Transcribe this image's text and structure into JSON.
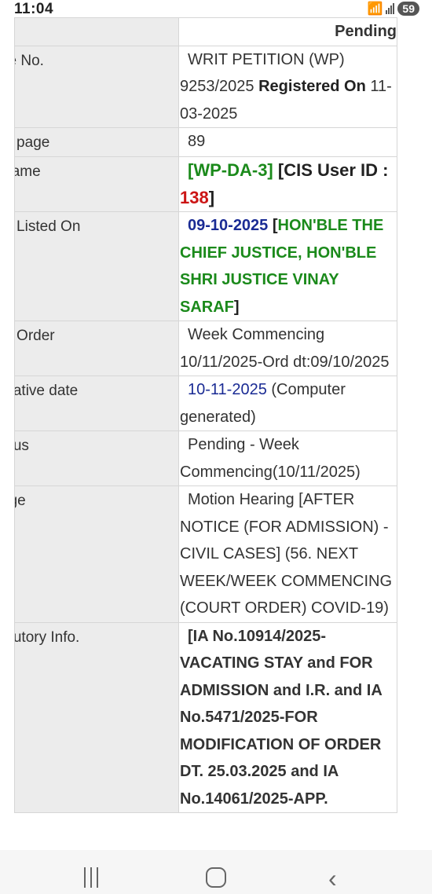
{
  "status_bar": {
    "time": "11:04",
    "battery": "59"
  },
  "header": {
    "status_title": "Pending"
  },
  "rows": [
    {
      "label": "se No.",
      "value": {
        "part1": "WRIT PETITION (WP) 9253/2025 ",
        "part2": "Registered On",
        "part3": " 11-03-2025"
      }
    },
    {
      "label": "st page",
      "value": "89"
    },
    {
      "label": " Name",
      "value": {
        "bench": "[WP-DA-3]",
        "cis": " [CIS User ID : ",
        "id": "138",
        "close": "]"
      }
    },
    {
      "label": "st Listed On",
      "value": {
        "date": "09-10-2025",
        "open": " [",
        "bench": "HON'BLE THE CHIEF JUSTICE, HON'BLE SHRI JUSTICE VINAY SARAF",
        "close": "]"
      }
    },
    {
      "label": "st Order",
      "value": "Week Commencing 10/11/2025-Ord dt:09/10/2025"
    },
    {
      "label": "ntative date",
      "value": {
        "date": "10-11-2025",
        "note": " (Computer generated)"
      }
    },
    {
      "label": "atus",
      "value": "Pending - Week Commencing(10/11/2025)"
    },
    {
      "label": "age",
      "value": "Motion Hearing [AFTER NOTICE (FOR ADMISSION) - CIVIL CASES] (56. NEXT WEEK/WEEK COMMENCING (COURT ORDER) COVID-19)"
    },
    {
      "label": "atutory Info.",
      "value": "[IA No.10914/2025-VACATING STAY and FOR ADMISSION and I.R. and IA No.5471/2025-FOR MODIFICATION OF ORDER DT. 25.03.2025 and IA No.14061/2025-APP."
    }
  ]
}
